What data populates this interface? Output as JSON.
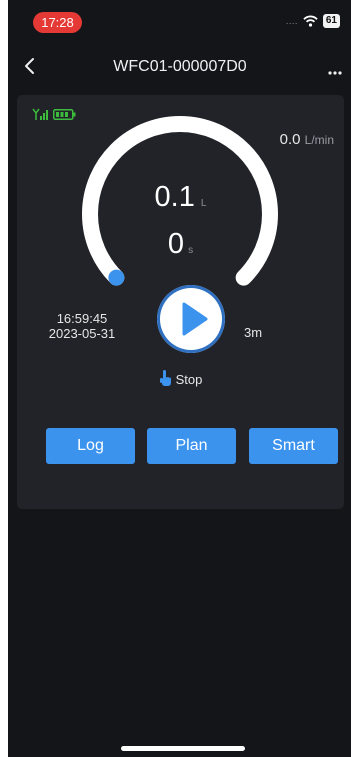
{
  "status_bar": {
    "time": "17:28",
    "signal_text": "....",
    "battery_level": "61"
  },
  "nav": {
    "title": "WFC01-000007D0",
    "back_icon": "chevron-left-icon",
    "more_icon": "more-dots-icon"
  },
  "device": {
    "signal_icon": "signal-bars-icon",
    "battery_icon": "battery-icon",
    "status_color": "#3dbb3d"
  },
  "meter": {
    "flow_rate": "0.0",
    "flow_rate_unit": "L/min",
    "volume": "0.1",
    "volume_unit": "L",
    "duration": "0",
    "duration_unit": "s",
    "last_time": "16:59:45",
    "last_date": "2023-05-31",
    "max_label": "3m",
    "progress_fraction": 0
  },
  "controls": {
    "play_icon": "play-icon",
    "stop_icon": "touch-hand-icon",
    "stop_label": "Stop",
    "accent_color": "#3b93ee"
  },
  "actions": {
    "log_label": "Log",
    "plan_label": "Plan",
    "smart_label": "Smart"
  }
}
